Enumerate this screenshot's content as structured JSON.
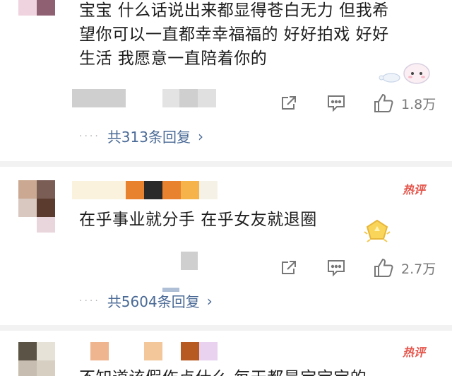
{
  "comments": [
    {
      "text_lines": [
        "宝宝 什么话说出来都显得苍白无力 但我希",
        "望你可以一直都幸幸福福的 好好拍戏 好好",
        "生活 我愿意一直陪着你的"
      ],
      "share_icon": "share-icon",
      "comment_icon": "comment-icon",
      "like_icon": "thumbs-up-icon",
      "likes": "1.8万",
      "replies_link": "共313条回复"
    },
    {
      "hot_badge": "热评",
      "text_lines": [
        "在乎事业就分手 在乎女友就退圈"
      ],
      "likes": "2.7万",
      "replies_link": "共5604条回复"
    },
    {
      "hot_badge": "热评",
      "text_lines": [
        "不知道该假作点什么 每天都是宝宝宝的"
      ]
    }
  ],
  "colors": {
    "link": "#4a6a96",
    "hot": "#e5544a",
    "icon": "#7a7a7a"
  }
}
